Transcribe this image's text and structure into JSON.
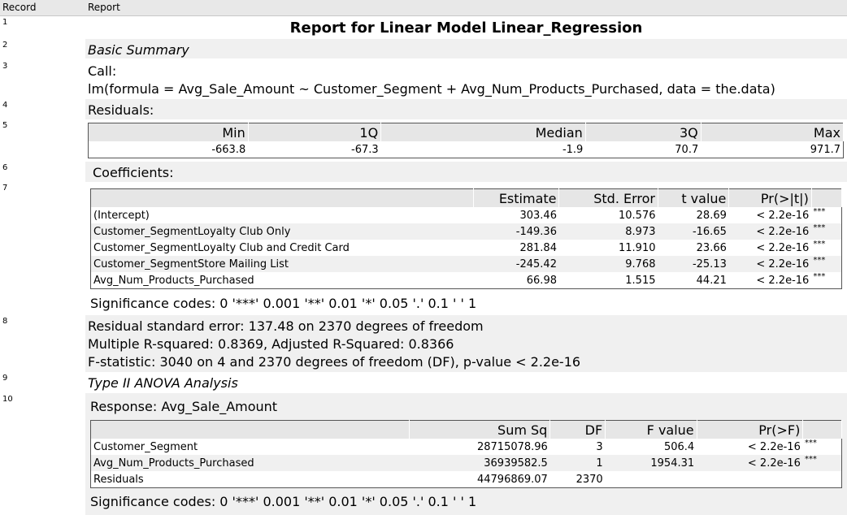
{
  "header": {
    "record": "Record",
    "report": "Report"
  },
  "records": [
    "1",
    "2",
    "3",
    "4",
    "5",
    "6",
    "7",
    "8",
    "9",
    "10"
  ],
  "title": "Report for Linear Model Linear_Regression",
  "basic_summary": "Basic Summary",
  "call_label": "Call:",
  "call_formula": "lm(formula = Avg_Sale_Amount ~ Customer_Segment + Avg_Num_Products_Purchased, data = the.data)",
  "residuals_label": "Residuals:",
  "residuals": {
    "headers": [
      "Min",
      "1Q",
      "Median",
      "3Q",
      "Max"
    ],
    "values": [
      "-663.8",
      "-67.3",
      "-1.9",
      "70.7",
      "971.7"
    ]
  },
  "coefficients_label": "Coefficients:",
  "coefficients": {
    "headers": [
      "Estimate",
      "Std. Error",
      "t value",
      "Pr(>|t|)"
    ],
    "rows": [
      {
        "name": "(Intercept)",
        "est": "303.46",
        "se": "10.576",
        "t": "28.69",
        "p": "< 2.2e-16",
        "sig": "***"
      },
      {
        "name": "Customer_SegmentLoyalty Club Only",
        "est": "-149.36",
        "se": "8.973",
        "t": "-16.65",
        "p": "< 2.2e-16",
        "sig": "***"
      },
      {
        "name": "Customer_SegmentLoyalty Club and Credit Card",
        "est": "281.84",
        "se": "11.910",
        "t": "23.66",
        "p": "< 2.2e-16",
        "sig": "***"
      },
      {
        "name": "Customer_SegmentStore Mailing List",
        "est": "-245.42",
        "se": "9.768",
        "t": "-25.13",
        "p": "< 2.2e-16",
        "sig": "***"
      },
      {
        "name": "Avg_Num_Products_Purchased",
        "est": "66.98",
        "se": "1.515",
        "t": "44.21",
        "p": "< 2.2e-16",
        "sig": "***"
      }
    ]
  },
  "signif_codes": "Significance codes: 0 '***' 0.001 '**' 0.01 '*' 0.05 '.' 0.1 ' ' 1",
  "stats": {
    "line1": "Residual standard error: 137.48 on 2370 degrees of freedom",
    "line2": "Multiple R-squared: 0.8369, Adjusted R-Squared: 0.8366",
    "line3": "F-statistic: 3040 on 4 and 2370 degrees of freedom (DF), p-value < 2.2e-16"
  },
  "anova_label": "Type II ANOVA Analysis",
  "response_label": "Response: Avg_Sale_Amount",
  "anova": {
    "headers": [
      "Sum Sq",
      "DF",
      "F value",
      "Pr(>F)"
    ],
    "rows": [
      {
        "name": "Customer_Segment",
        "ss": "28715078.96",
        "df": "3",
        "f": "506.4",
        "p": "< 2.2e-16",
        "sig": "***"
      },
      {
        "name": "Avg_Num_Products_Purchased",
        "ss": "36939582.5",
        "df": "1",
        "f": "1954.31",
        "p": "< 2.2e-16",
        "sig": "***"
      },
      {
        "name": "Residuals",
        "ss": "44796869.07",
        "df": "2370",
        "f": "",
        "p": "",
        "sig": ""
      }
    ]
  },
  "signif_codes_2": "Significance codes: 0 '***' 0.001 '**' 0.01 '*' 0.05 '.' 0.1 ' ' 1"
}
